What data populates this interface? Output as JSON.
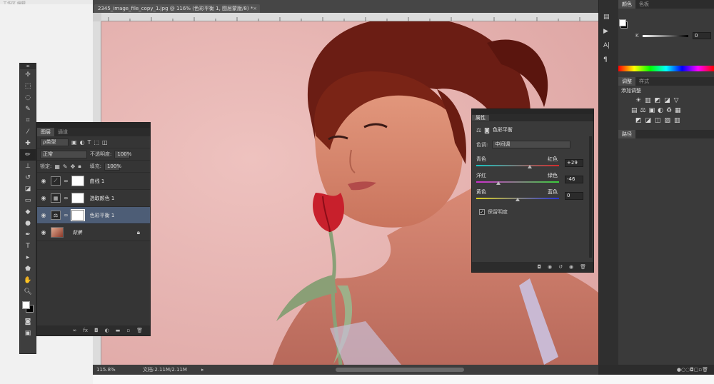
{
  "app": {
    "top_left_text": "工作区 编辑",
    "doc_tab_title": "2345_image_file_copy_1.jpg @ 116% (色彩平衡 1, 图层蒙版/8) *",
    "doc_tab_close": "×"
  },
  "status": {
    "zoom": "115.8%",
    "doc_size": "文档:2.11M/2.11M",
    "arrow": "▸"
  },
  "layers_panel": {
    "tabs": [
      "图层",
      "通道"
    ],
    "filter_label": "ρ类型",
    "blend_mode": "正常",
    "opacity_label": "不透明度:",
    "opacity_value": "100%",
    "lock_label": "锁定:",
    "fill_label": "填充:",
    "fill_value": "100%",
    "layers": [
      {
        "name": "曲线 1",
        "icon": "curves-icon"
      },
      {
        "name": "选取颜色 1",
        "icon": "selective-color-icon"
      },
      {
        "name": "色彩平衡 1",
        "icon": "color-balance-icon"
      },
      {
        "name": "背景",
        "icon": "background-thumb"
      }
    ]
  },
  "properties_panel": {
    "tab": "属性",
    "title": "色彩平衡",
    "tone_label": "色调:",
    "tone_value": "中间调",
    "sliders": [
      {
        "left": "青色",
        "right": "红色",
        "value": "+29",
        "level": 0.645
      },
      {
        "left": "洋红",
        "right": "绿色",
        "value": "-46",
        "level": 0.27
      },
      {
        "left": "黄色",
        "right": "蓝色",
        "value": "0",
        "level": 0.5
      }
    ],
    "preserve_label": "保留明度",
    "preserve_checked": true
  },
  "right_panel": {
    "color_tabs": [
      "颜色",
      "色板"
    ],
    "k_label": "K",
    "k_value": "0",
    "adj_tabs": [
      "调整",
      "样式"
    ],
    "add_adjustment": "添加调整",
    "paths_tab": "路径"
  },
  "colors": {
    "canvas": "#e8b4b1",
    "selected_layer": "#4d5d76"
  }
}
